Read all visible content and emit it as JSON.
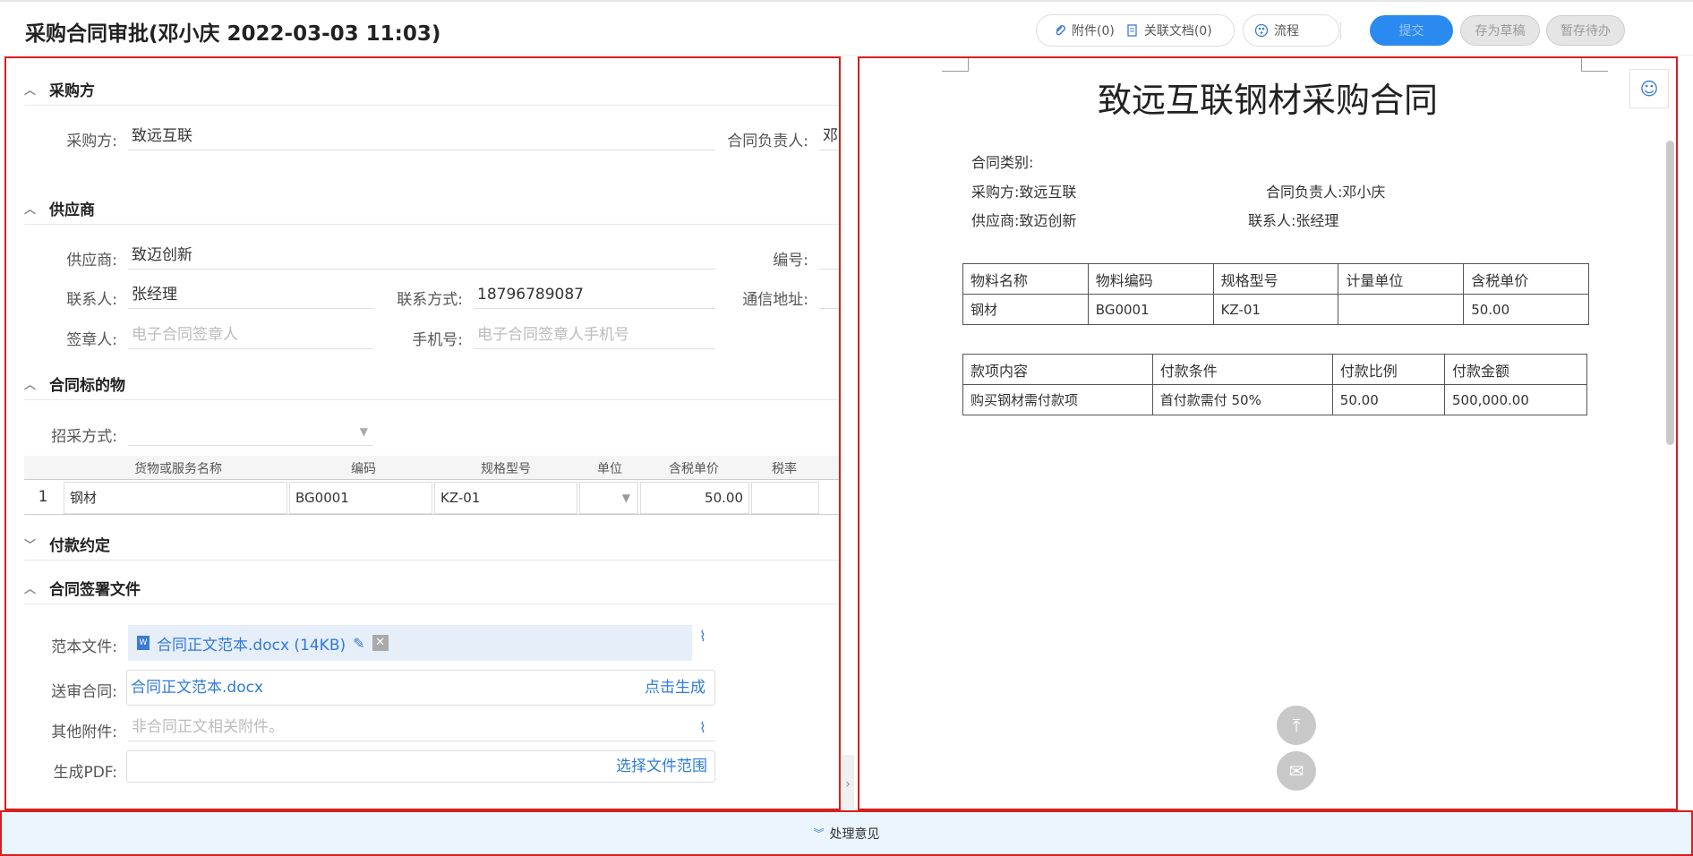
{
  "header": {
    "title": "采购合同审批(邓小庆 2022-03-03 11:03)",
    "attach": "附件(0)",
    "related": "关联文档(0)",
    "flow": "流程",
    "submit": "提交",
    "save_draft": "存为草稿",
    "save_todo": "暂存待办"
  },
  "form": {
    "buyer_section": "采购方",
    "buyer_label": "采购方:",
    "buyer_value": "致远互联",
    "owner_label": "合同负责人:",
    "owner_value": "邓",
    "supplier_section": "供应商",
    "supplier_label": "供应商:",
    "supplier_value": "致迈创新",
    "code_label": "编号:",
    "contact_label": "联系人:",
    "contact_value": "张经理",
    "phone_label": "联系方式:",
    "phone_value": "18796789087",
    "address_label": "通信地址:",
    "signer_label": "签章人:",
    "signer_placeholder": "电子合同签章人",
    "mobile_label": "手机号:",
    "mobile_placeholder": "电子合同签章人手机号",
    "subject_section": "合同标的物",
    "method_label": "招采方式:",
    "grid_headers": [
      "货物或服务名称",
      "编码",
      "规格型号",
      "单位",
      "含税单价",
      "税率"
    ],
    "grid_row": {
      "index": "1",
      "name": "钢材",
      "code": "BG0001",
      "spec": "KZ-01",
      "price": "50.00"
    },
    "payment_section": "付款约定",
    "files_section": "合同签署文件",
    "template_label": "范本文件:",
    "template_file": "合同正文范本.docx (14KB)",
    "review_label": "送审合同:",
    "review_file": "合同正文范本.docx",
    "generate": "点击生成",
    "other_label": "其他附件:",
    "other_placeholder": "非合同正文相关附件。",
    "pdf_label": "生成PDF:",
    "pick_range": "选择文件范围"
  },
  "doc": {
    "title": "致远互联钢材采购合同",
    "type_line": "合同类别:",
    "buyer_line": "采购方:致远互联",
    "owner_line": "合同负责人:邓小庆",
    "supplier_line": "供应商:致迈创新",
    "contact_line": "联系人:张经理",
    "table1_headers": [
      "物料名称",
      "物料编码",
      "规格型号",
      "计量单位",
      "含税单价"
    ],
    "table1_row": [
      "钢材",
      "BG0001",
      "KZ-01",
      "",
      "50.00"
    ],
    "table2_headers": [
      "款项内容",
      "付款条件",
      "付款比例",
      "付款金额"
    ],
    "table2_row": [
      "购买钢材需付款项",
      "首付款需付 50%",
      "50.00",
      "500,000.00"
    ]
  },
  "footer": {
    "opinion": "处理意见"
  }
}
